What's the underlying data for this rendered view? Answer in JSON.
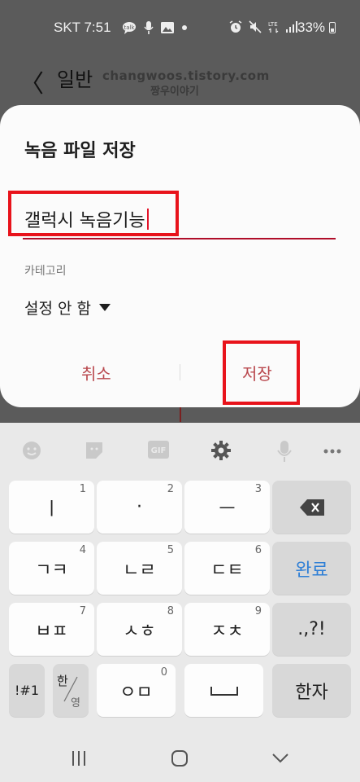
{
  "status_bar": {
    "carrier_time": "SKT 7:51",
    "battery": "33%"
  },
  "app_header": {
    "back_glyph": "〈",
    "title": "일반"
  },
  "watermark": {
    "line1": "changwoos.tistory.com",
    "line2": "짱우이야기"
  },
  "dialog": {
    "title": "녹음 파일 저장",
    "filename_value": "갤럭시 녹음기능",
    "category_label": "카테고리",
    "category_value": "설정 안 함",
    "cancel_label": "취소",
    "save_label": "저장"
  },
  "keyboard": {
    "rows": [
      [
        {
          "label": "ㅣ",
          "num": "1"
        },
        {
          "label": "·",
          "num": "2"
        },
        {
          "label": "ㅡ",
          "num": "3"
        },
        {
          "label": "⌫",
          "num": ""
        }
      ],
      [
        {
          "label": "ㄱㅋ",
          "num": "4"
        },
        {
          "label": "ㄴㄹ",
          "num": "5"
        },
        {
          "label": "ㄷㅌ",
          "num": "6"
        },
        {
          "label": "완료",
          "num": ""
        }
      ],
      [
        {
          "label": "ㅂㅍ",
          "num": "7"
        },
        {
          "label": "ㅅㅎ",
          "num": "8"
        },
        {
          "label": "ㅈㅊ",
          "num": "9"
        },
        {
          "label": ".,?!",
          "num": ""
        }
      ]
    ],
    "symbols_key": "!#1",
    "lang_key_top": "한",
    "lang_key_bottom": "영",
    "key_om": "ㅇㅁ",
    "zero_num": "0",
    "hanja_key": "한자",
    "done_color": "#2f7fd6"
  },
  "accent": {
    "highlight_red": "#e8131b",
    "button_text": "#b9484e"
  }
}
